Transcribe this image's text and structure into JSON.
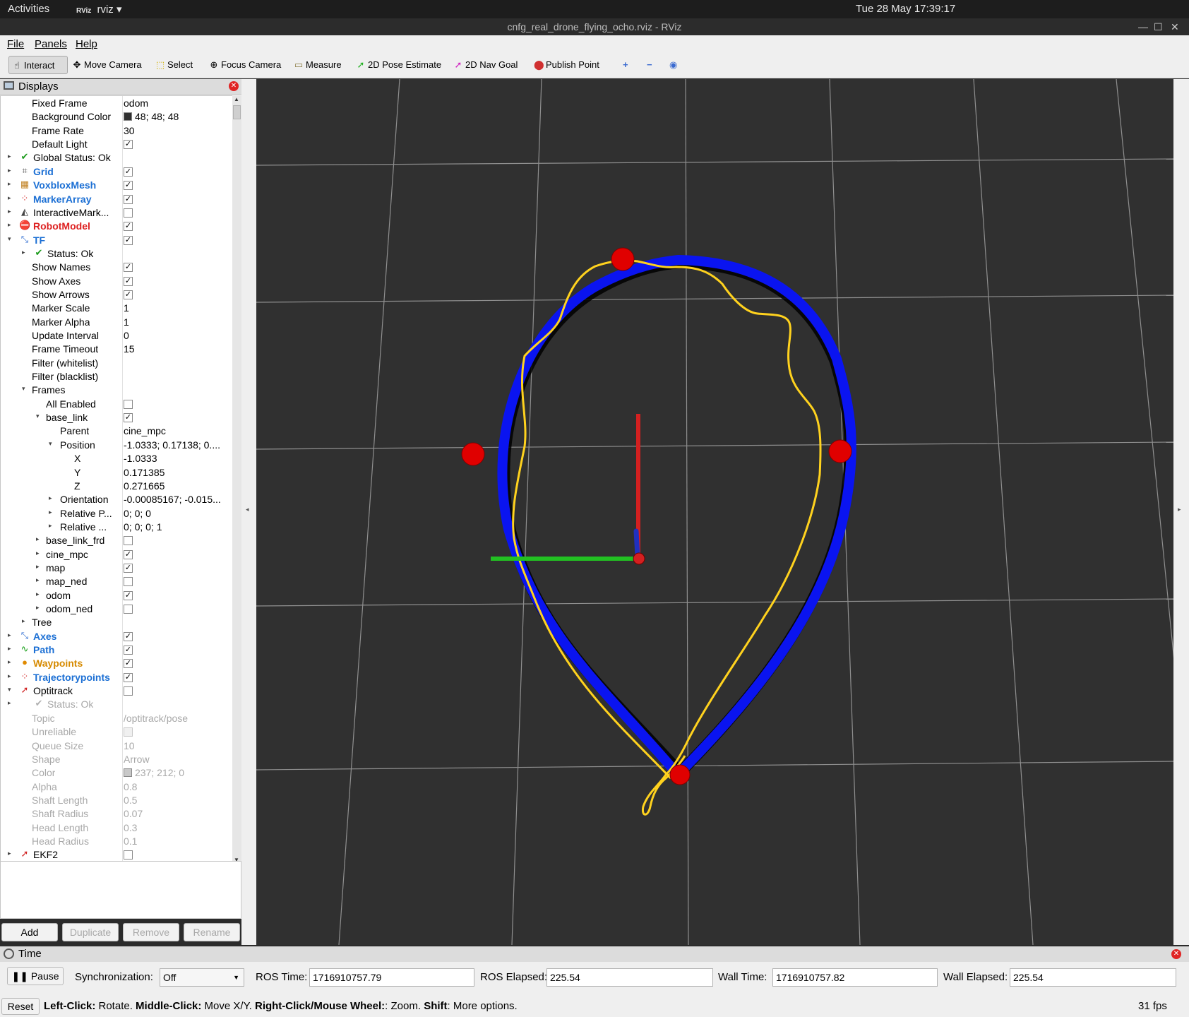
{
  "topbar": {
    "activities": "Activities",
    "app_icon": "RViz",
    "app_name": "rviz",
    "clock": "Tue 28 May  17:39:17"
  },
  "window": {
    "title": "cnfg_real_drone_flying_ocho.rviz - RViz"
  },
  "menu": [
    "File",
    "Panels",
    "Help"
  ],
  "toolbar": {
    "tools": [
      {
        "label": "Interact",
        "icon": "interact-icon"
      },
      {
        "label": "Move Camera",
        "icon": "move-camera-icon"
      },
      {
        "label": "Select",
        "icon": "select-icon"
      },
      {
        "label": "Focus Camera",
        "icon": "focus-camera-icon"
      },
      {
        "label": "Measure",
        "icon": "measure-icon"
      },
      {
        "label": "2D Pose Estimate",
        "icon": "pose-estimate-icon"
      },
      {
        "label": "2D Nav Goal",
        "icon": "nav-goal-icon"
      },
      {
        "label": "Publish Point",
        "icon": "publish-point-icon"
      }
    ]
  },
  "displays": {
    "title": "Displays",
    "rows": [
      {
        "label": "Fixed Frame",
        "value": "odom"
      },
      {
        "label": "Background Color",
        "value": "48; 48; 48",
        "swatch": "#303030"
      },
      {
        "label": "Frame Rate",
        "value": "30"
      },
      {
        "label": "Default Light",
        "check": true
      },
      {
        "label": "Global Status: Ok",
        "icon": "check-icon"
      },
      {
        "label": "Grid",
        "check": true,
        "style": "blue",
        "icon": "grid-icon"
      },
      {
        "label": "VoxbloxMesh",
        "check": true,
        "style": "blue",
        "icon": "mesh-icon"
      },
      {
        "label": "MarkerArray",
        "check": true,
        "style": "blue",
        "icon": "marker-array-icon"
      },
      {
        "label": "InteractiveMark...",
        "check": false,
        "icon": "interactive-marker-icon"
      },
      {
        "label": "RobotModel",
        "check": true,
        "style": "red",
        "icon": "error-icon"
      },
      {
        "label": "TF",
        "check": true,
        "style": "blue",
        "icon": "tf-icon"
      },
      {
        "label": "Status: Ok",
        "icon": "check-icon"
      },
      {
        "label": "Show Names",
        "check": true
      },
      {
        "label": "Show Axes",
        "check": true
      },
      {
        "label": "Show Arrows",
        "check": true
      },
      {
        "label": "Marker Scale",
        "value": "1"
      },
      {
        "label": "Marker Alpha",
        "value": "1"
      },
      {
        "label": "Update Interval",
        "value": "0"
      },
      {
        "label": "Frame Timeout",
        "value": "15"
      },
      {
        "label": "Filter (whitelist)",
        "value": ""
      },
      {
        "label": "Filter (blacklist)",
        "value": ""
      },
      {
        "label": "Frames"
      },
      {
        "label": "All Enabled",
        "check": false
      },
      {
        "label": "base_link",
        "check": true
      },
      {
        "label": "Parent",
        "value": "cine_mpc"
      },
      {
        "label": "Position",
        "value": "-1.0333; 0.17138; 0...."
      },
      {
        "label": "X",
        "value": "-1.0333"
      },
      {
        "label": "Y",
        "value": "0.171385"
      },
      {
        "label": "Z",
        "value": "0.271665"
      },
      {
        "label": "Orientation",
        "value": "-0.00085167; -0.015..."
      },
      {
        "label": "Relative P...",
        "value": "0; 0; 0"
      },
      {
        "label": "Relative ...",
        "value": "0; 0; 0; 1"
      },
      {
        "label": "base_link_frd",
        "check": false
      },
      {
        "label": "cine_mpc",
        "check": true
      },
      {
        "label": "map",
        "check": true
      },
      {
        "label": "map_ned",
        "check": false
      },
      {
        "label": "odom",
        "check": true
      },
      {
        "label": "odom_ned",
        "check": false
      },
      {
        "label": "Tree"
      },
      {
        "label": "Axes",
        "check": true,
        "style": "blue",
        "icon": "axes-icon"
      },
      {
        "label": "Path",
        "check": true,
        "style": "blue",
        "icon": "path-icon"
      },
      {
        "label": "Waypoints",
        "check": true,
        "style": "orange",
        "icon": "warning-icon"
      },
      {
        "label": "Trajectorypoints",
        "check": true,
        "style": "blue",
        "icon": "marker-array-icon"
      },
      {
        "label": "Optitrack",
        "check": false,
        "icon": "pose-icon"
      },
      {
        "label": "Status: Ok",
        "style": "gray",
        "icon": "check-icon"
      },
      {
        "label": "Topic",
        "value": "/optitrack/pose",
        "style": "gray"
      },
      {
        "label": "Unreliable",
        "check": false,
        "style": "gray"
      },
      {
        "label": "Queue Size",
        "value": "10",
        "style": "gray"
      },
      {
        "label": "Shape",
        "value": "Arrow",
        "style": "gray"
      },
      {
        "label": "Color",
        "value": "237; 212; 0",
        "swatch": "#c8c8c8",
        "style": "gray"
      },
      {
        "label": "Alpha",
        "value": "0.8",
        "style": "gray"
      },
      {
        "label": "Shaft Length",
        "value": "0.5",
        "style": "gray"
      },
      {
        "label": "Shaft Radius",
        "value": "0.07",
        "style": "gray"
      },
      {
        "label": "Head Length",
        "value": "0.3",
        "style": "gray"
      },
      {
        "label": "Head Radius",
        "value": "0.1",
        "style": "gray"
      },
      {
        "label": "EKF2",
        "check": false,
        "icon": "pose-icon"
      }
    ]
  },
  "panel_buttons": {
    "add": "Add",
    "duplicate": "Duplicate",
    "remove": "Remove",
    "rename": "Rename"
  },
  "time": {
    "title": "Time",
    "pause": "Pause",
    "sync_label": "Synchronization:",
    "sync_value": "Off",
    "ros_time_label": "ROS Time:",
    "ros_time": "1716910757.79",
    "ros_elapsed_label": "ROS Elapsed:",
    "ros_elapsed": "225.54",
    "wall_time_label": "Wall Time:",
    "wall_time": "1716910757.82",
    "wall_elapsed_label": "Wall Elapsed:",
    "wall_elapsed": "225.54"
  },
  "status": {
    "reset": "Reset",
    "hint_parts": [
      {
        "text": "Left-Click:",
        "bold": true
      },
      {
        "text": " Rotate. "
      },
      {
        "text": "Middle-Click:",
        "bold": true
      },
      {
        "text": " Move X/Y. "
      },
      {
        "text": "Right-Click/Mouse Wheel:",
        "bold": true
      },
      {
        "text": ": Zoom. "
      },
      {
        "text": "Shift",
        "bold": true
      },
      {
        "text": ": More options."
      }
    ],
    "fps": "31 fps"
  },
  "colors": {
    "background": "#303030",
    "planned_path": "#0a14f0",
    "actual_path": "#ffd21e",
    "waypoint": "#e00000",
    "axis_x": "#d42020",
    "axis_y": "#22c022",
    "axis_z": "#2030c0",
    "grid": "#a0a0a0"
  }
}
